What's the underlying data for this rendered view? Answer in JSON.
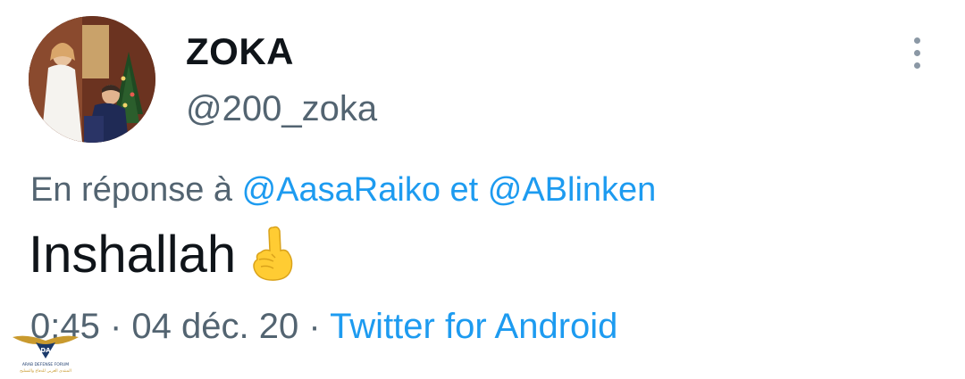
{
  "tweet": {
    "display_name": "ZOKA",
    "handle": "@200_zoka",
    "reply_prefix": "En réponse à ",
    "reply_to_1": "@AasaRaiko",
    "reply_joiner": " et ",
    "reply_to_2": "@ABlinken",
    "text": "Inshallah",
    "emoji": "pointing-up-finger-emoji",
    "time": "0:45",
    "separator": " · ",
    "date": "04 déc. 20",
    "source": "Twitter for Android"
  },
  "icons": {
    "more": "more-vertical-icon"
  },
  "watermark": {
    "abbr": "DA",
    "line1": "ARAB DEFENSE FORUM",
    "line2": "المنتدى العربي للدفاع والتسليح"
  },
  "colors": {
    "text_primary": "#0f1419",
    "text_secondary": "#536471",
    "link": "#1d9bf0",
    "background": "#ffffff"
  }
}
